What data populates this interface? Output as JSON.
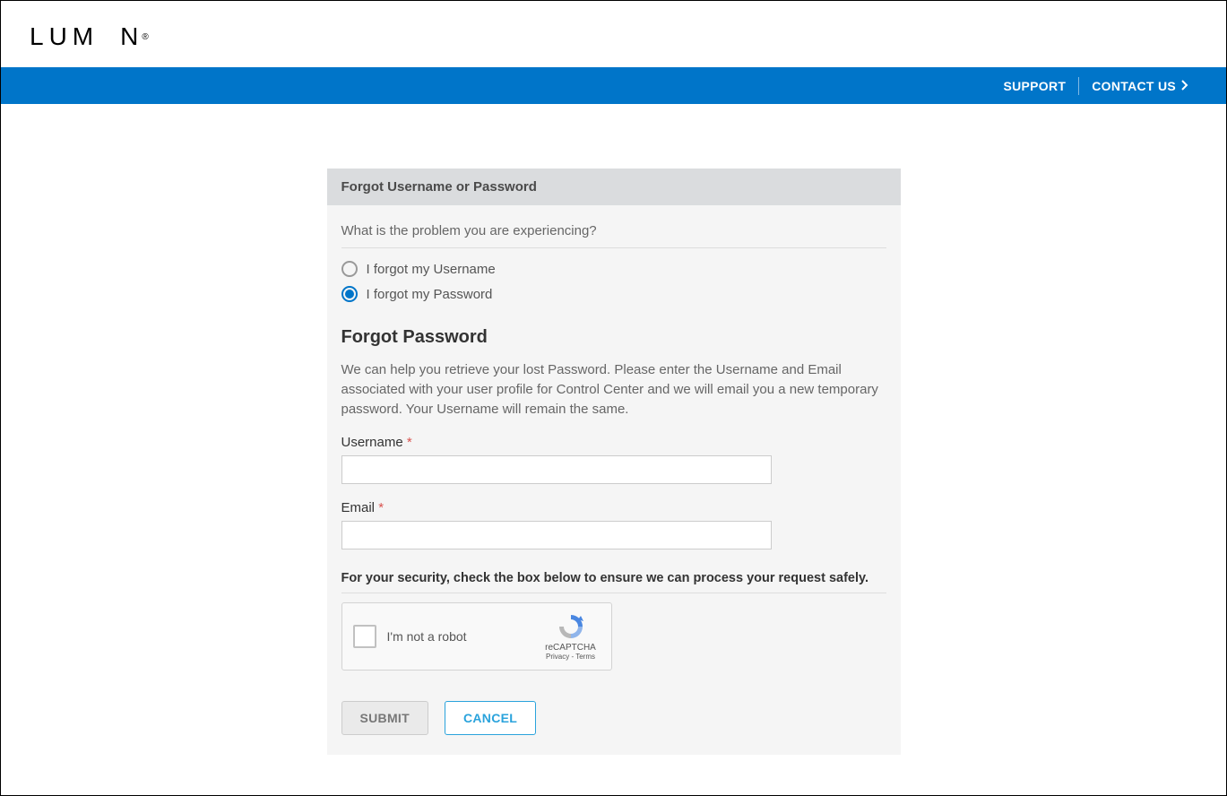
{
  "logo": {
    "text_left": "LUM",
    "text_right": "N",
    "registered": "®"
  },
  "nav": {
    "support": "SUPPORT",
    "contact": "CONTACT US"
  },
  "card": {
    "header": "Forgot Username or Password",
    "question": "What is the problem you are experiencing?",
    "radios": {
      "username": "I forgot my Username",
      "password": "I forgot my Password"
    },
    "section_title": "Forgot Password",
    "help_text": "We can help you retrieve your lost Password. Please enter the Username and Email associated with your user profile for Control Center and we will email you a new temporary password. Your Username will remain the same.",
    "fields": {
      "username_label": "Username",
      "email_label": "Email",
      "required_mark": "*"
    },
    "security_text": "For your security, check the box below to ensure we can process your request safely.",
    "recaptcha": {
      "label": "I'm not a robot",
      "brand": "reCAPTCHA",
      "privacy": "Privacy",
      "dash": " - ",
      "terms": "Terms"
    },
    "buttons": {
      "submit": "SUBMIT",
      "cancel": "CANCEL"
    }
  }
}
